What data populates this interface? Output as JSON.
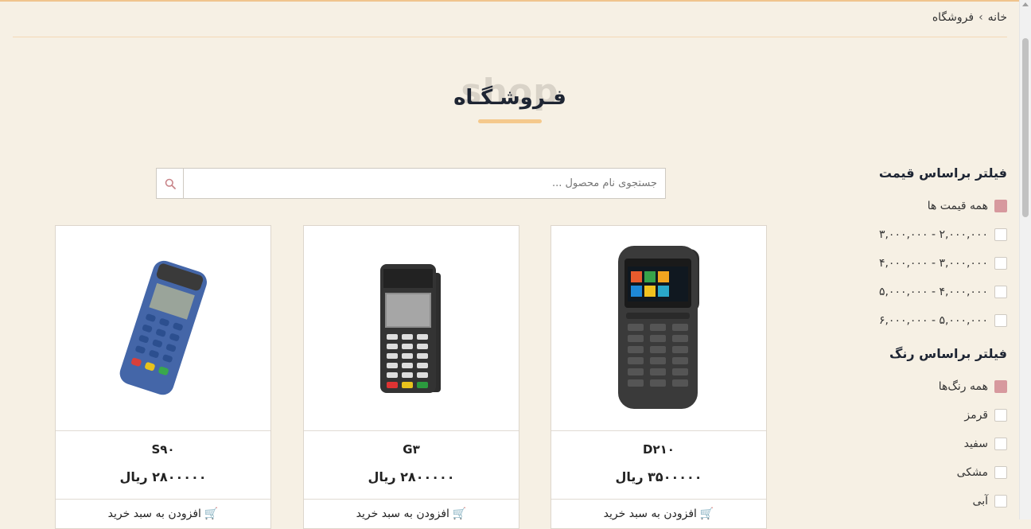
{
  "breadcrumb": {
    "home": "خانه",
    "current": "فروشگاه"
  },
  "page": {
    "bg_word": "shop",
    "title": "فـروشـگـاه"
  },
  "search": {
    "placeholder": "جستجوی نام محصول ..."
  },
  "products": [
    {
      "name": "D۲۱۰",
      "price": "۳۵۰۰۰۰۰ ریال",
      "add_to_cart": "افزودن به سبد خرید"
    },
    {
      "name": "G۳",
      "price": "۲۸۰۰۰۰۰ ریال",
      "add_to_cart": "افزودن به سبد خرید"
    },
    {
      "name": "S۹۰",
      "price": "۲۸۰۰۰۰۰ ریال",
      "add_to_cart": "افزودن به سبد خرید"
    }
  ],
  "filters": {
    "price": {
      "title": "فیلتر براساس قیمت",
      "options": [
        {
          "label": "همه قیمت ها",
          "checked": true
        },
        {
          "label": "۲,۰۰۰,۰۰۰ - ۳,۰۰۰,۰۰۰",
          "checked": false
        },
        {
          "label": "۳,۰۰۰,۰۰۰ - ۴,۰۰۰,۰۰۰",
          "checked": false
        },
        {
          "label": "۴,۰۰۰,۰۰۰ - ۵,۰۰۰,۰۰۰",
          "checked": false
        },
        {
          "label": "۵,۰۰۰,۰۰۰ - ۶,۰۰۰,۰۰۰",
          "checked": false
        }
      ]
    },
    "color": {
      "title": "فیلتر براساس رنگ",
      "options": [
        {
          "label": "همه رنگ‌ها",
          "checked": true
        },
        {
          "label": "قرمز",
          "checked": false
        },
        {
          "label": "سفید",
          "checked": false
        },
        {
          "label": "مشکی",
          "checked": false
        },
        {
          "label": "آبی",
          "checked": false
        }
      ]
    }
  },
  "colors": {
    "accent": "#f5c98c",
    "checkbox_on": "#d7999e",
    "background": "#f6f0e4"
  }
}
